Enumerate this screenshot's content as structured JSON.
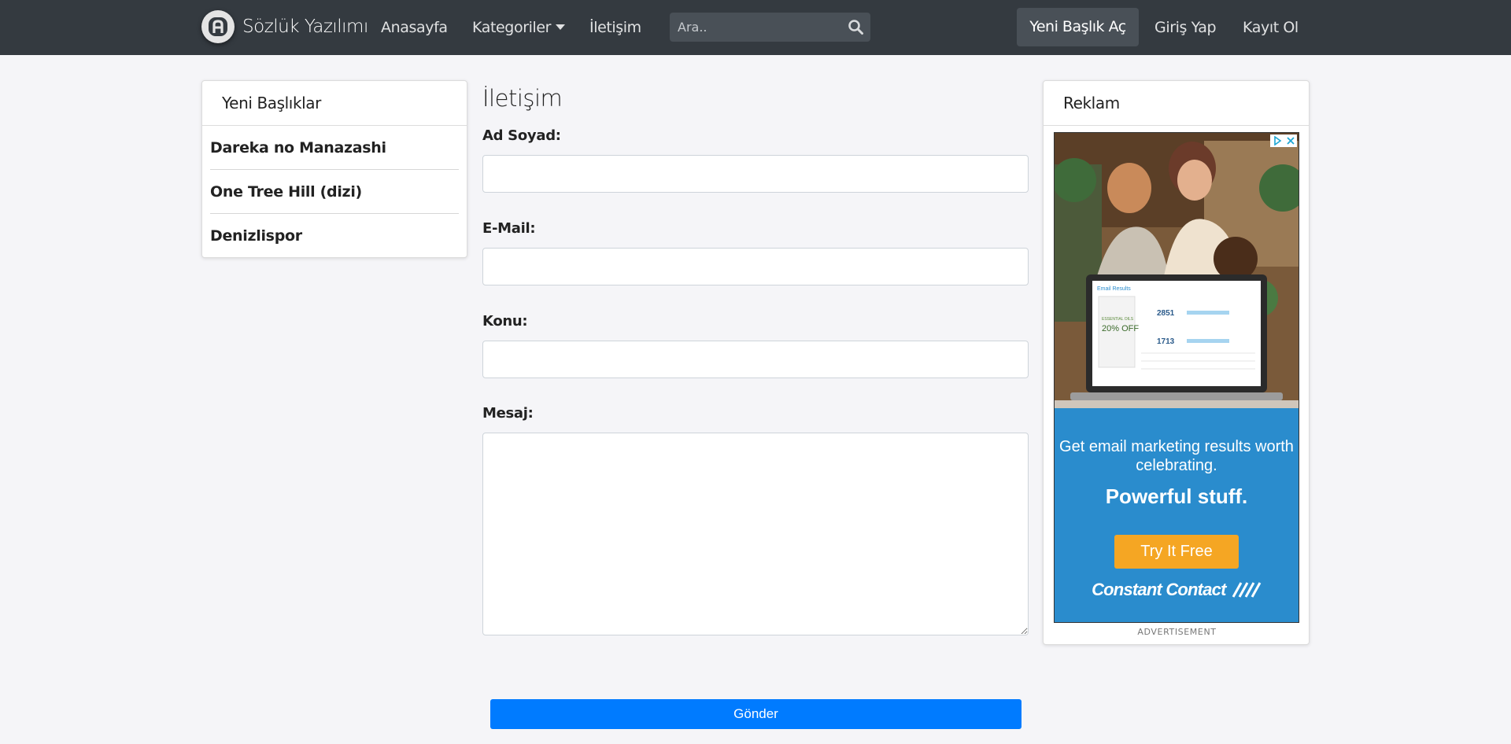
{
  "navbar": {
    "brand": "Sözlük Yazılımı",
    "links": {
      "home": "Anasayfa",
      "categories": "Kategoriler",
      "contact": "İletişim"
    },
    "search_placeholder": "Ara..",
    "new_topic": "Yeni Başlık Aç",
    "login": "Giriş Yap",
    "register": "Kayıt Ol"
  },
  "sidebar": {
    "title": "Yeni Başlıklar",
    "items": [
      {
        "label": "Dareka no Manazashi"
      },
      {
        "label": "One Tree Hill (dizi)"
      },
      {
        "label": "Denizlispor"
      }
    ]
  },
  "form": {
    "title": "İletişim",
    "name_label": "Ad Soyad:",
    "email_label": "E-Mail:",
    "subject_label": "Konu:",
    "message_label": "Mesaj:",
    "name_value": "",
    "email_value": "",
    "subject_value": "",
    "message_value": "",
    "submit": "Gönder"
  },
  "ad": {
    "header": "Reklam",
    "line1": "Get email marketing results worth celebrating.",
    "line2": "Powerful stuff.",
    "cta": "Try It Free",
    "brand": "Constant Contact",
    "mock_title": "Email Results",
    "mock_offer_top": "ESSENTIAL OILS",
    "mock_offer": "20% OFF",
    "mock_stat_1": "2851",
    "mock_stat_2": "1713",
    "label": "ADVERTISEMENT"
  },
  "colors": {
    "navbar": "#343a40",
    "nav_button": "#495057",
    "primary": "#007bff",
    "ad_blue": "#2a8ccd",
    "ad_cta": "#f5a623",
    "page_bg": "#f5f5f8"
  },
  "icons": [
    "brand-logo-icon",
    "search-icon",
    "chevron-down-icon",
    "ad-choices-icon",
    "close-icon",
    "constant-contact-logo-icon"
  ]
}
